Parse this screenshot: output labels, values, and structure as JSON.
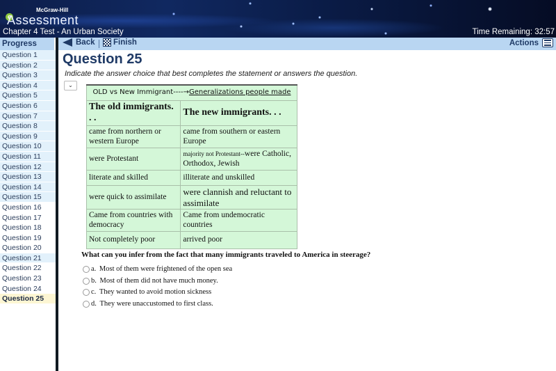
{
  "header": {
    "brand_small": "McGraw-Hill",
    "brand_e": "e",
    "brand_main": "Assessment",
    "test_title": "Chapter 4 Test - An Urban Society",
    "time_remaining": "Time Remaining: 32:57"
  },
  "sidebar": {
    "title": "Progress",
    "items": [
      {
        "label": "Question 1",
        "state": "answered"
      },
      {
        "label": "Question 2",
        "state": "answered"
      },
      {
        "label": "Question 3",
        "state": "answered"
      },
      {
        "label": "Question 4",
        "state": "answered"
      },
      {
        "label": "Question 5",
        "state": "answered"
      },
      {
        "label": "Question 6",
        "state": "answered"
      },
      {
        "label": "Question 7",
        "state": "answered"
      },
      {
        "label": "Question 8",
        "state": "answered"
      },
      {
        "label": "Question 9",
        "state": "answered"
      },
      {
        "label": "Question 10",
        "state": "answered"
      },
      {
        "label": "Question 11",
        "state": "answered"
      },
      {
        "label": "Question 12",
        "state": "answered"
      },
      {
        "label": "Question 13",
        "state": "answered"
      },
      {
        "label": "Question 14",
        "state": "answered"
      },
      {
        "label": "Question 15",
        "state": "answered"
      },
      {
        "label": "Question 16",
        "state": "unanswered"
      },
      {
        "label": "Question 17",
        "state": "unanswered"
      },
      {
        "label": "Question 18",
        "state": "unanswered"
      },
      {
        "label": "Question 19",
        "state": "unanswered"
      },
      {
        "label": "Question 20",
        "state": "unanswered"
      },
      {
        "label": "Question 21",
        "state": "answered"
      },
      {
        "label": "Question 22",
        "state": "unanswered"
      },
      {
        "label": "Question 23",
        "state": "unanswered"
      },
      {
        "label": "Question 24",
        "state": "unanswered"
      },
      {
        "label": "Question 25",
        "state": "current"
      }
    ]
  },
  "toolbar": {
    "back_label": "Back",
    "finish_label": "Finish",
    "actions_label": "Actions"
  },
  "main": {
    "question_title": "Question 25",
    "instruction": "Indicate the answer choice that best completes the statement or answers the question.",
    "select_value": "",
    "select_icon": "⌄",
    "image_table": {
      "caption_left": "OLD vs New Immigrant----→",
      "caption_right": "Generalizations people made",
      "headers": [
        "The old immigrants. . .",
        "The new immigrants. . ."
      ],
      "rows": [
        [
          "came from northern or western Europe",
          "came from southern or eastern Europe"
        ],
        [
          "were Protestant",
          "majority not Protestant--",
          "were Catholic, Orthodox, Jewish"
        ],
        [
          "literate and skilled",
          "illiterate and unskilled"
        ],
        [
          "were quick to assimilate",
          "were clannish and reluctant to assimilate"
        ],
        [
          "Came from countries with democracy",
          "Came from undemocratic countries"
        ],
        [
          "Not completely poor",
          "arrived poor"
        ]
      ]
    },
    "question_text": "What can you infer from the fact that many immigrants traveled to America in steerage?",
    "choices": [
      {
        "letter": "a.",
        "text": "Most of them were frightened of the open sea"
      },
      {
        "letter": "b.",
        "text": "Most of them did not have much money."
      },
      {
        "letter": "c.",
        "text": "They wanted to avoid motion sickness"
      },
      {
        "letter": "d.",
        "text": "They were unaccustomed to first class."
      }
    ]
  }
}
